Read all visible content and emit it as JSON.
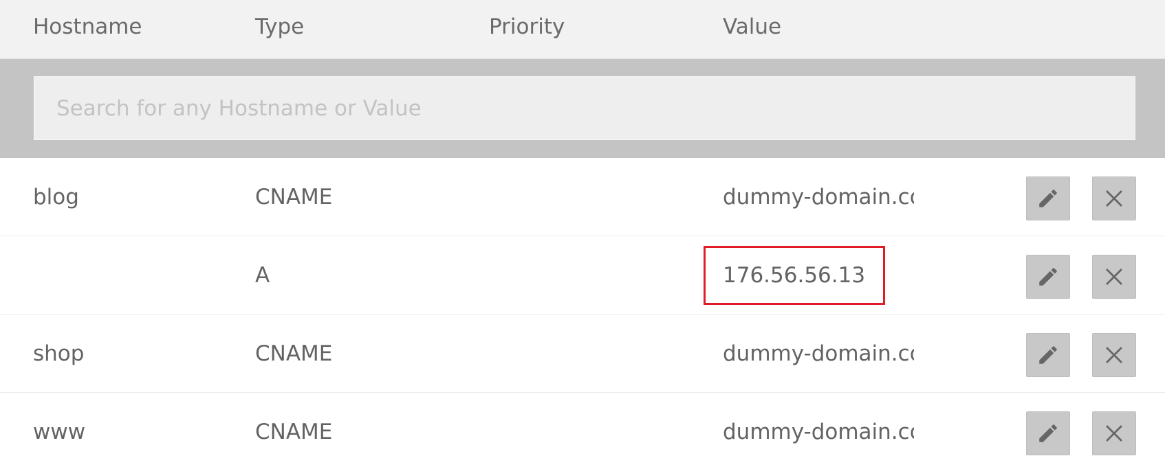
{
  "columns": {
    "hostname": "Hostname",
    "type": "Type",
    "priority": "Priority",
    "value": "Value"
  },
  "search": {
    "placeholder": "Search for any Hostname or Value",
    "value": ""
  },
  "records": [
    {
      "hostname": "blog",
      "type": "CNAME",
      "priority": "",
      "value": "dummy-domain.com",
      "highlighted": false
    },
    {
      "hostname": "",
      "type": "A",
      "priority": "",
      "value": "176.56.56.13",
      "highlighted": true
    },
    {
      "hostname": "shop",
      "type": "CNAME",
      "priority": "",
      "value": "dummy-domain.com",
      "highlighted": false
    },
    {
      "hostname": "www",
      "type": "CNAME",
      "priority": "",
      "value": "dummy-domain.com",
      "highlighted": false
    }
  ],
  "icons": {
    "edit": "pencil-icon",
    "delete": "close-icon"
  },
  "colors": {
    "header_bg": "#f2f2f2",
    "search_band_bg": "#c4c4c4",
    "button_bg": "#c8c8c8",
    "highlight": "#e01c24"
  }
}
